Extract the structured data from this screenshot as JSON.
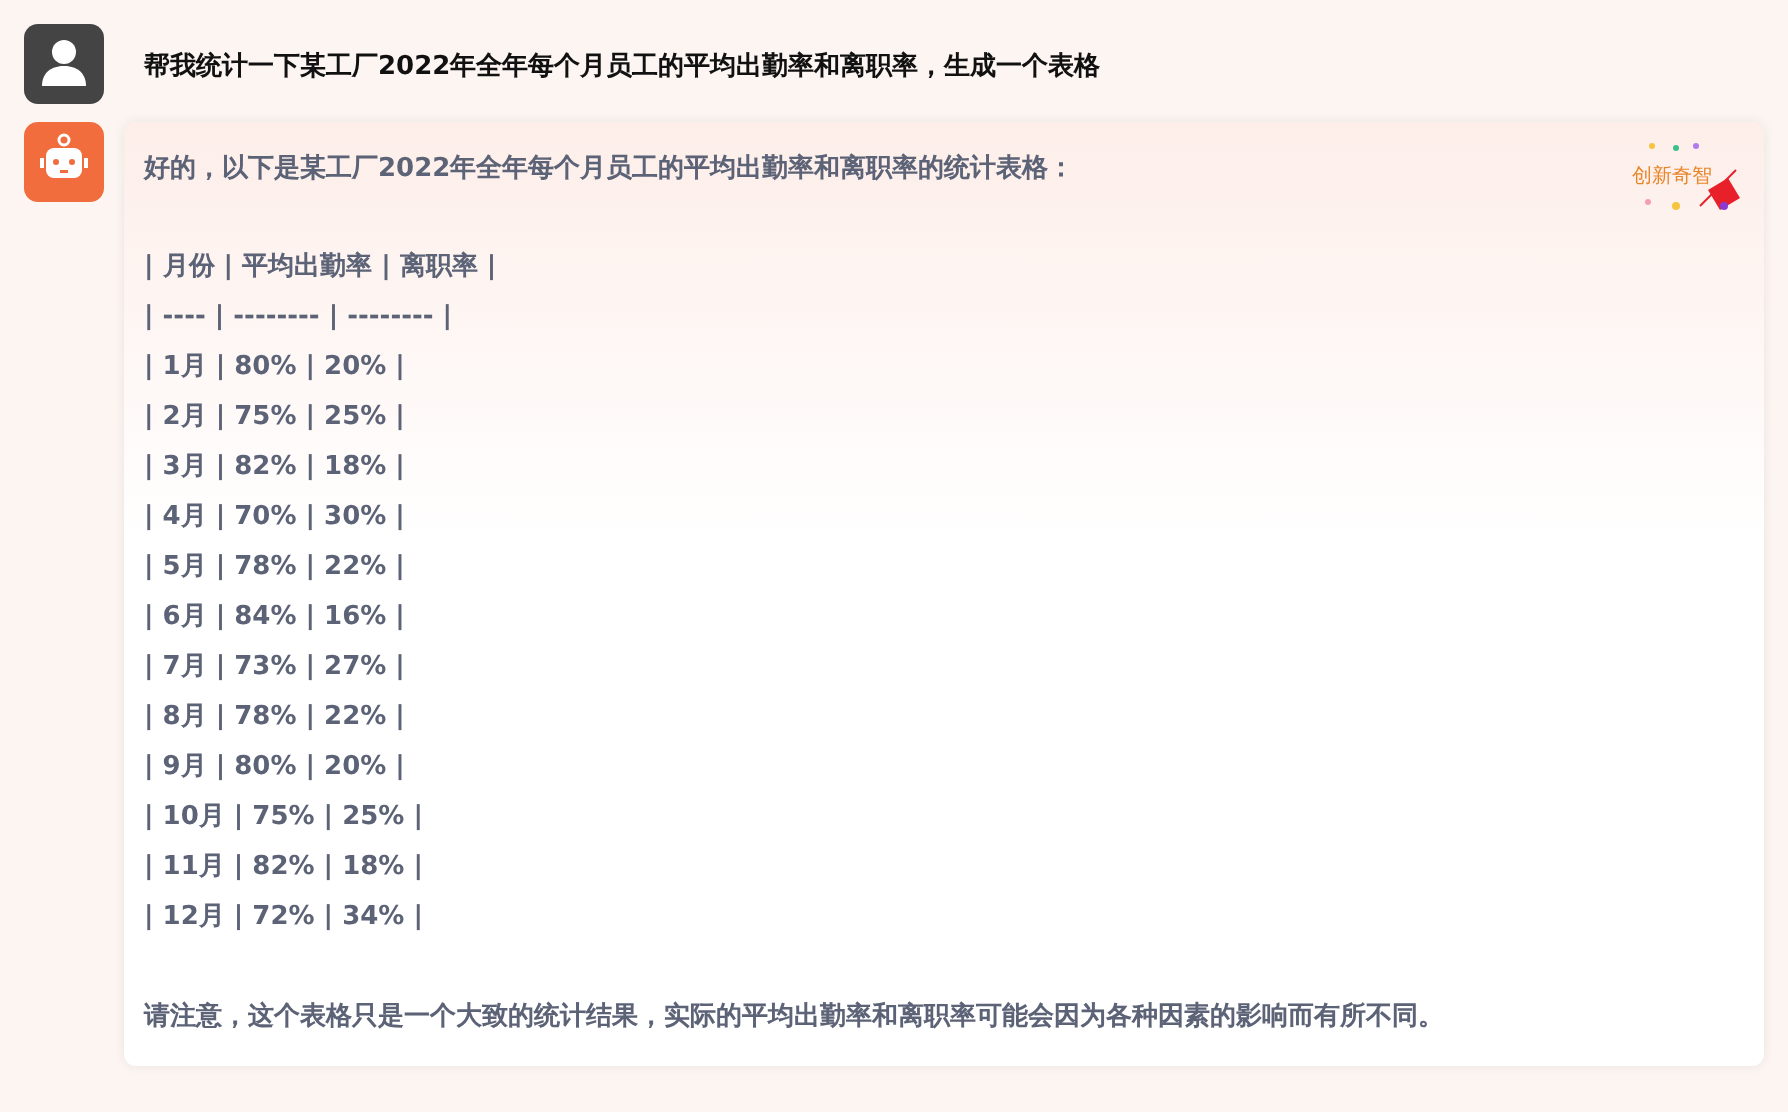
{
  "user_message": {
    "text": "帮我统计一下某工厂2022年全年每个月员工的平均出勤率和离职率，生成一个表格"
  },
  "reply": {
    "intro": "好的，以下是某工厂2022年全年每个月员工的平均出勤率和离职率的统计表格：",
    "badge": "创新奇智",
    "table_lines": [
      "| 月份 | 平均出勤率 | 离职率 |",
      "| ---- | -------- | -------- |",
      "| 1月 | 80% | 20% |",
      "| 2月 | 75% | 25% |",
      "| 3月 | 82% | 18% |",
      "| 4月 | 70% | 30% |",
      "| 5月 | 78% | 22% |",
      "| 6月 | 84% | 16% |",
      "| 7月 | 73% | 27% |",
      "| 8月 | 78% | 22% |",
      "| 9月 | 80% | 20% |",
      "| 10月 | 75% | 25% |",
      "| 11月 | 82% | 18% |",
      "| 12月 | 72% | 34% |"
    ],
    "note": "请注意，这个表格只是一个大致的统计结果，实际的平均出勤率和离职率可能会因为各种因素的影响而有所不同。"
  }
}
